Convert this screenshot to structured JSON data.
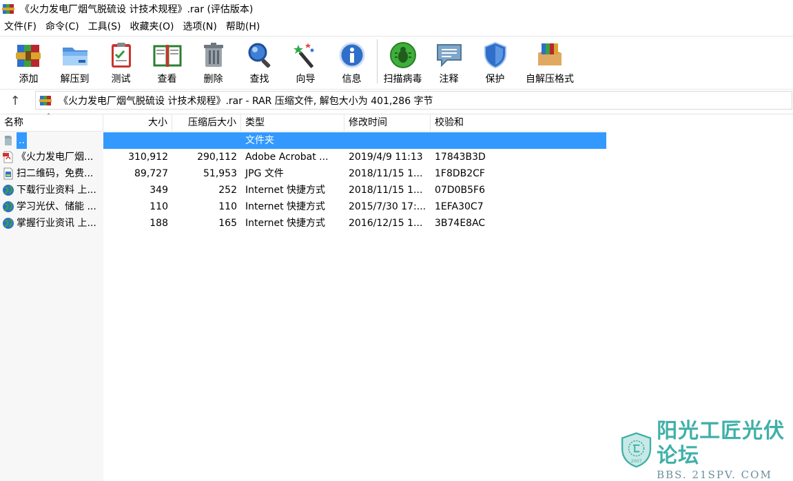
{
  "window": {
    "title": "《火力发电厂烟气脱硫设 计技术规程》.rar (评估版本)"
  },
  "menu": [
    "文件(F)",
    "命令(C)",
    "工具(S)",
    "收藏夹(O)",
    "选项(N)",
    "帮助(H)"
  ],
  "toolbar": {
    "add": "添加",
    "extract": "解压到",
    "test": "测试",
    "view": "查看",
    "delete": "删除",
    "find": "查找",
    "wizard": "向导",
    "info": "信息",
    "virus": "扫描病毒",
    "comment": "注释",
    "protect": "保护",
    "sfx": "自解压格式"
  },
  "address": {
    "text": "《火力发电厂烟气脱硫设 计技术规程》.rar - RAR 压缩文件, 解包大小为 401,286 字节"
  },
  "columns": {
    "name": "名称",
    "size": "大小",
    "packed": "压缩后大小",
    "type": "类型",
    "modified": "修改时间",
    "crc": "校验和"
  },
  "rows": [
    {
      "name": "..",
      "size": "",
      "packed": "",
      "type": "文件夹",
      "modified": "",
      "crc": "",
      "icon": "folder-up-icon"
    },
    {
      "name": "《火力发电厂烟...",
      "size": "310,912",
      "packed": "290,112",
      "type": "Adobe Acrobat ...",
      "modified": "2019/4/9 11:13",
      "crc": "17843B3D",
      "icon": "pdf-file-icon"
    },
    {
      "name": "扫二维码，免费...",
      "size": "89,727",
      "packed": "51,953",
      "type": "JPG 文件",
      "modified": "2018/11/15 1...",
      "crc": "1F8DB2CF",
      "icon": "image-file-icon"
    },
    {
      "name": "下载行业资料 上...",
      "size": "349",
      "packed": "252",
      "type": "Internet 快捷方式",
      "modified": "2018/11/15 1...",
      "crc": "07D0B5F6",
      "icon": "internet-shortcut-icon"
    },
    {
      "name": "学习光伏、储能 ...",
      "size": "110",
      "packed": "110",
      "type": "Internet 快捷方式",
      "modified": "2015/7/30 17:...",
      "crc": "1EFA30C7",
      "icon": "internet-shortcut-icon"
    },
    {
      "name": "掌握行业资讯 上...",
      "size": "188",
      "packed": "165",
      "type": "Internet 快捷方式",
      "modified": "2016/12/15 1...",
      "crc": "3B74E8AC",
      "icon": "internet-shortcut-icon"
    }
  ],
  "watermark": {
    "cn": "阳光工匠光伏论坛",
    "en": "BBS. 21SPV. COM",
    "seal_year": "2007"
  },
  "colors": {
    "selection": "#3399ff",
    "watermark": "#3fb0a8"
  }
}
